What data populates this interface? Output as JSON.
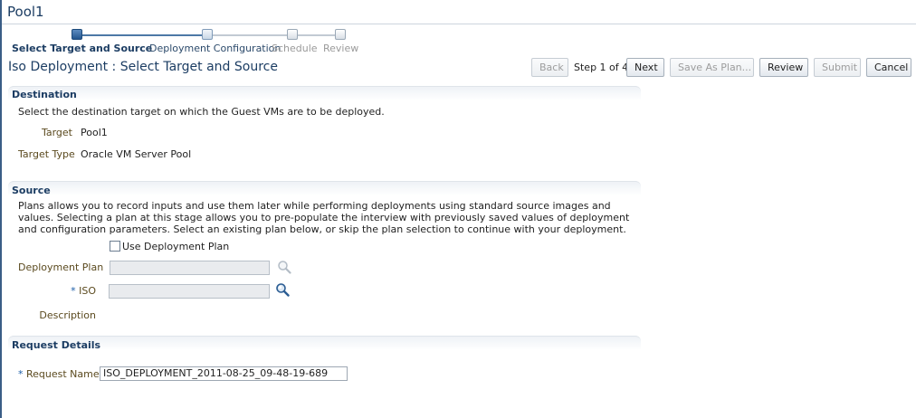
{
  "page": {
    "title": "Pool1",
    "subtitle": "Iso Deployment : Select Target and Source"
  },
  "train": {
    "steps": [
      {
        "label": "Select Target and Source",
        "state": "current"
      },
      {
        "label": "Deployment Configuration",
        "state": "next"
      },
      {
        "label": "Schedule",
        "state": "disabled"
      },
      {
        "label": "Review",
        "state": "disabled"
      }
    ]
  },
  "toolbar": {
    "back_label": "Back",
    "step_text": "Step 1 of 4",
    "next_label": "Next",
    "save_plan_label": "Save As Plan...",
    "review_label": "Review",
    "submit_label": "Submit",
    "cancel_label": "Cancel"
  },
  "destination": {
    "title": "Destination",
    "instructions": "Select the destination target on which the Guest VMs are to be deployed.",
    "target_label": "Target",
    "target_value": "Pool1",
    "target_type_label": "Target Type",
    "target_type_value": "Oracle VM Server Pool"
  },
  "source": {
    "title": "Source",
    "description": "Plans allows you to record inputs and use them later while performing deployments using standard source images and values. Selecting a plan at this stage allows you to pre-populate the interview with previously saved values of deployment and configuration parameters. Select an existing plan below, or skip the plan selection to continue with your deployment.",
    "use_plan_label": "Use Deployment Plan",
    "use_plan_checked": false,
    "deployment_plan_label": "Deployment Plan",
    "deployment_plan_value": "",
    "iso_required_mark": "*",
    "iso_label": "ISO",
    "iso_value": "",
    "description_label": "Description"
  },
  "request": {
    "title": "Request Details",
    "required_mark": "*",
    "name_label": "Request Name",
    "name_value": "ISO_DEPLOYMENT_2011-08-25_09-48-19-689"
  },
  "colors": {
    "accent": "#1c3d63",
    "label": "#5b4a1f",
    "required": "#1c5ea8"
  },
  "icons": {
    "plan_search": "search-icon",
    "iso_search": "search-icon"
  }
}
